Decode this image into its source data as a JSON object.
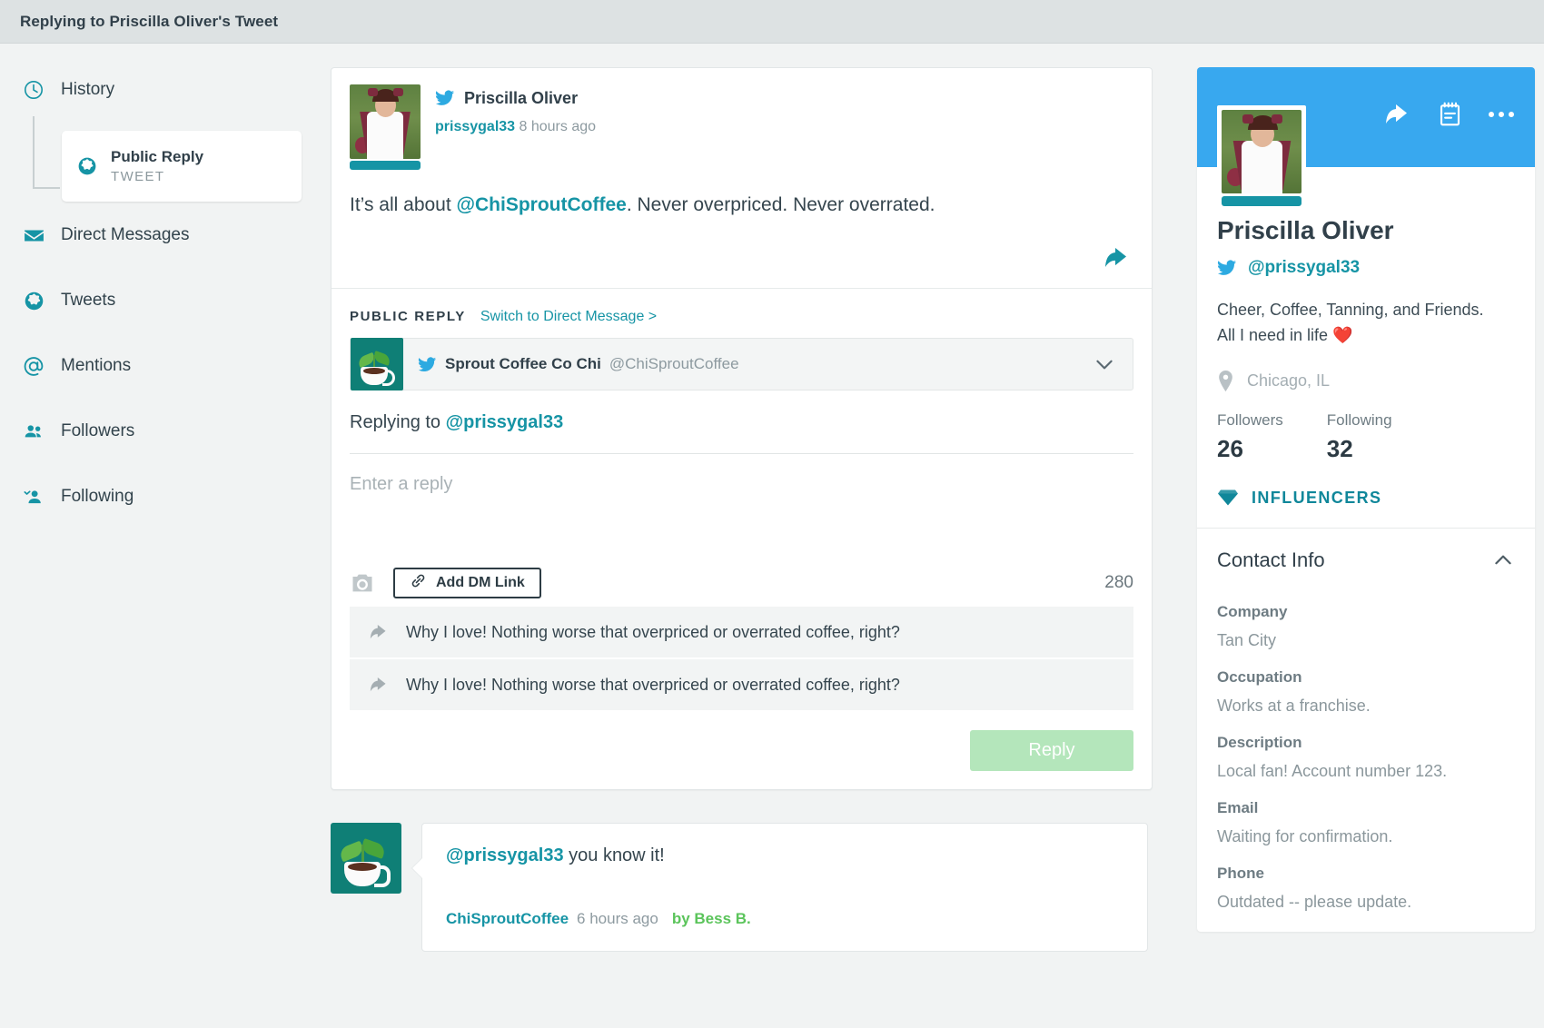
{
  "topbar": {
    "title": "Replying to Priscilla Oliver's Tweet"
  },
  "sidebar": {
    "items": [
      {
        "label": "History",
        "icon": "clock-icon"
      },
      {
        "label": "Direct Messages",
        "icon": "envelope-icon"
      },
      {
        "label": "Tweets",
        "icon": "globe-icon"
      },
      {
        "label": "Mentions",
        "icon": "at-icon"
      },
      {
        "label": "Followers",
        "icon": "users-icon"
      },
      {
        "label": "Following",
        "icon": "user-check-icon"
      }
    ],
    "history_child": {
      "title": "Public Reply",
      "subtitle": "TWEET",
      "icon": "globe-icon"
    }
  },
  "tweet": {
    "author_name": "Priscilla Oliver",
    "handle": "prissygal33",
    "time": "8 hours ago",
    "text_before": "It’s all about ",
    "mention": "@ChiSproutCoffee",
    "text_after": ". Never overpriced. Never overrated."
  },
  "composer": {
    "section_label": "PUBLIC REPLY",
    "switch_link": "Switch to Direct Message >",
    "profile_name": "Sprout Coffee Co Chi",
    "profile_handle": "@ChiSproutCoffee",
    "replying_to_prefix": "Replying to ",
    "replying_to_handle": "@prissygal33",
    "input_placeholder": "Enter a reply",
    "input_value": "",
    "add_dm_link_label": "Add DM Link",
    "char_count": "280",
    "suggestions": [
      "Why I love! Nothing worse that overpriced or overrated coffee, right?",
      "Why I love! Nothing worse that overpriced or overrated coffee, right?"
    ],
    "reply_button": "Reply"
  },
  "message": {
    "mention": "@prissygal33",
    "text": " you know it!",
    "handle": "ChiSproutCoffee",
    "time": "6 hours ago",
    "by": "by Bess B."
  },
  "profile": {
    "name": "Priscilla Oliver",
    "handle": "@prissygal33",
    "bio_line1": "Cheer, Coffee, Tanning, and Friends.",
    "bio_line2": "All I need in life ❤️",
    "location": "Chicago, IL",
    "followers_label": "Followers",
    "followers_value": "26",
    "following_label": "Following",
    "following_value": "32",
    "influencers_label": "INFLUENCERS",
    "contact_info_title": "Contact Info",
    "fields": [
      {
        "label": "Company",
        "value": "Tan City"
      },
      {
        "label": "Occupation",
        "value": "Works at a franchise."
      },
      {
        "label": "Description",
        "value": "Local fan! Account number 123."
      },
      {
        "label": "Email",
        "value": "Waiting for confirmation."
      },
      {
        "label": "Phone",
        "value": "Outdated -- please update."
      }
    ]
  },
  "colors": {
    "teal": "#1694a5",
    "twitter_blue": "#38a8ef",
    "reply_green": "#b4e6bb",
    "by_green": "#5bc45b",
    "topbar_bg": "#dde2e3"
  }
}
